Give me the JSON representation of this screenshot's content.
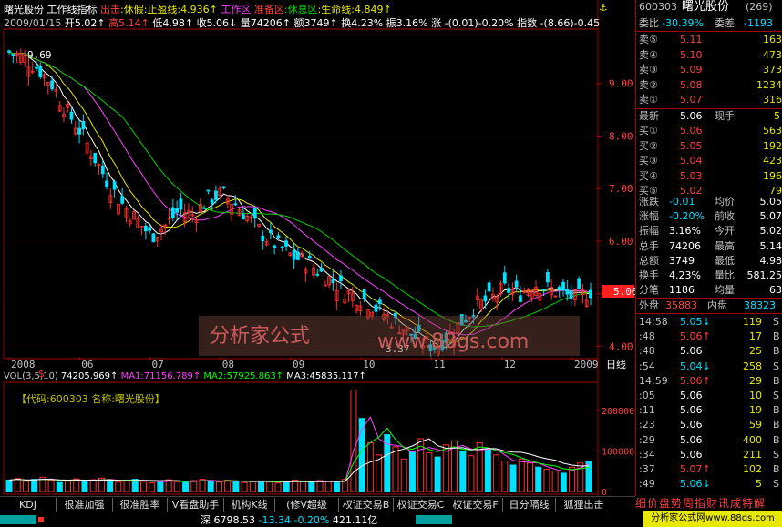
{
  "header": {
    "title": "曙光股份",
    "indicator": "工作线指标",
    "exit_label": "出击",
    "vacation": ":休假:止盈线:4.936↑",
    "work_zone": "工作区",
    "prep_zone": "准备区",
    "rest_zone": ":休息区",
    "life_line": ":生命线:4.849↑"
  },
  "ohlc": {
    "date": "2009/01/15",
    "open": "开5.02↑",
    "high": "高5.14↑",
    "low": "低4.98↑",
    "close": "收5.06↓",
    "volume": "量74206↑",
    "amount": "额3749↑",
    "turnover": "换4.23%",
    "amplitude": "振3.16%",
    "change": "涨 -(0.01)-0.20%",
    "index": "指数 -(8.66)-0.45"
  },
  "chart_data": {
    "type": "candlestick",
    "ylim": [
      3.8,
      10.0
    ],
    "yticks": [
      "9.00",
      "8.00",
      "7.00",
      "6.00",
      "5.00",
      "4.00"
    ],
    "xticks": [
      "2008",
      "06",
      "07",
      "08",
      "09",
      "10",
      "11",
      "12",
      "2009"
    ],
    "axis_label": "日线",
    "high_label": "9.69",
    "low_label": "3.37",
    "current_price": "5.06",
    "price_series": [
      9.6,
      9.5,
      9.3,
      9.0,
      8.5,
      8.1,
      7.6,
      7.1,
      6.7,
      6.4,
      6.1,
      6.3,
      6.6,
      6.5,
      6.8,
      6.9,
      6.7,
      6.4,
      6.1,
      5.9,
      5.7,
      5.6,
      5.4,
      5.2,
      5.0,
      4.9,
      4.7,
      4.5,
      4.3,
      4.1,
      4.0,
      4.2,
      4.5,
      4.8,
      4.9,
      5.1,
      5.0,
      5.2,
      5.1,
      5.0,
      4.9,
      5.06
    ],
    "volume": {
      "header": "VOL(3,5,10)",
      "value": "74205.969↑",
      "ma1": "MA1:71156.789↑",
      "ma2": "MA2:57925.863↑",
      "ma3": "MA3:45835.117↑",
      "yticks": [
        "200000",
        "100000",
        "0"
      ],
      "ylim": [
        0,
        260000
      ],
      "values": [
        28000,
        32000,
        25000,
        30000,
        35000,
        27000,
        22000,
        26000,
        31000,
        24000,
        29000,
        33000,
        27000,
        23000,
        28000,
        30000,
        25000,
        21000,
        26000,
        29000,
        24000,
        22000,
        27000,
        30000,
        26000,
        23000,
        28000,
        25000,
        22000,
        24000,
        26000,
        23000,
        21000,
        25000,
        28000,
        24000,
        22000,
        27000,
        25000,
        21000,
        30000,
        250000,
        180000,
        120000,
        90000,
        140000,
        110000,
        80000,
        100000,
        130000,
        95000,
        85000,
        115000,
        125000,
        100000,
        88000,
        120000,
        105000,
        90000,
        75000,
        65000,
        80000,
        70000,
        60000,
        55000,
        50000,
        45000,
        60000,
        70000,
        74206
      ]
    }
  },
  "stock": {
    "info": "【代码:600303 名称:曙光股份】"
  },
  "quote": {
    "code": "600303",
    "name": "曙光股份",
    "num": "(269)",
    "weibi": "委比",
    "weibi_val": "-30.39%",
    "weicha": "委差",
    "weicha_val": "-1193",
    "sells": [
      {
        "label": "卖⑤",
        "price": "5.11",
        "vol": "163"
      },
      {
        "label": "卖④",
        "price": "5.10",
        "vol": "473"
      },
      {
        "label": "卖③",
        "price": "5.09",
        "vol": "373"
      },
      {
        "label": "卖②",
        "price": "5.08",
        "vol": "1234"
      },
      {
        "label": "卖①",
        "price": "5.07",
        "vol": "316"
      }
    ],
    "last_label": "最新",
    "last_val": "5.06",
    "hand_label": "现手",
    "hand_val": "5",
    "buys": [
      {
        "label": "买①",
        "price": "5.06",
        "vol": "563"
      },
      {
        "label": "买②",
        "price": "5.05",
        "vol": "192"
      },
      {
        "label": "买③",
        "price": "5.04",
        "vol": "423"
      },
      {
        "label": "买④",
        "price": "5.03",
        "vol": "196"
      },
      {
        "label": "买⑤",
        "price": "5.02",
        "vol": "79"
      }
    ],
    "stats": [
      {
        "l1": "涨跌",
        "v1": "-0.01",
        "l2": "均价",
        "v2": "5.05"
      },
      {
        "l1": "涨幅",
        "v1": "-0.20%",
        "l2": "前收",
        "v2": "5.07"
      },
      {
        "l1": "振幅",
        "v1": "3.16%",
        "l2": "今开",
        "v2": "5.02"
      },
      {
        "l1": "总手",
        "v1": "74206",
        "l2": "最高",
        "v2": "5.14"
      },
      {
        "l1": "总额",
        "v1": "3749",
        "l2": "最低",
        "v2": "4.98"
      },
      {
        "l1": "换手",
        "v1": "4.23%",
        "l2": "量比",
        "v2": "581.25"
      },
      {
        "l1": "分笔",
        "v1": "1186",
        "l2": "均量",
        "v2": "63"
      }
    ],
    "outer_label": "外盘",
    "outer_val": "35883",
    "inner_label": "内盘",
    "inner_val": "38323",
    "ticks": [
      {
        "t": "14:58",
        "p": "5.05",
        "a": "↓",
        "v": "119",
        "s": "S"
      },
      {
        "t": ":48",
        "p": "5.06",
        "a": "↑",
        "v": "17",
        "s": "B"
      },
      {
        "t": ":48",
        "p": "5.06",
        "a": "",
        "v": "25",
        "s": "B"
      },
      {
        "t": ":54",
        "p": "5.04",
        "a": "↓",
        "v": "258",
        "s": "S"
      },
      {
        "t": "14:59",
        "p": "5.06",
        "a": "↑",
        "v": "29",
        "s": "B"
      },
      {
        "t": ":05",
        "p": "5.06",
        "a": "",
        "v": "10",
        "s": "S"
      },
      {
        "t": ":11",
        "p": "5.06",
        "a": "",
        "v": "19",
        "s": "B"
      },
      {
        "t": ":23",
        "p": "5.06",
        "a": "",
        "v": "59",
        "s": "B"
      },
      {
        "t": ":29",
        "p": "5.06",
        "a": "",
        "v": "400",
        "s": "B"
      },
      {
        "t": ":34",
        "p": "5.06",
        "a": "",
        "v": "211",
        "s": "S"
      },
      {
        "t": ":37",
        "p": "5.07",
        "a": "↑",
        "v": "102",
        "s": "B"
      },
      {
        "t": ":49",
        "p": "5.06",
        "a": "↓",
        "v": "5",
        "s": "S"
      }
    ],
    "bottom_tabs": "细价盘势周指财讯成特解"
  },
  "tabs": [
    "KDJ",
    "很准加强",
    "很准胜率",
    "V看盘助手",
    "机构K线",
    "(修V超级MACD)",
    "权证交易B",
    "权证交易C",
    "权证交易F",
    "日分隔线",
    "狐狸出击"
  ],
  "status": {
    "market": "深",
    "index": "6798.53",
    "change": "-13.34",
    "pct": "-0.20%",
    "amount": "421.11亿",
    "site": "分析家公式网www.88gs.com"
  },
  "watermark": {
    "text1": "分析家公式",
    "text2": "www.88gs.com"
  },
  "colors": {
    "up": "#ff3030",
    "down": "#00e0ff",
    "yellow": "#e8e800",
    "green": "#00d000",
    "label": "#c0c0c0",
    "panel_border": "#a00000"
  }
}
